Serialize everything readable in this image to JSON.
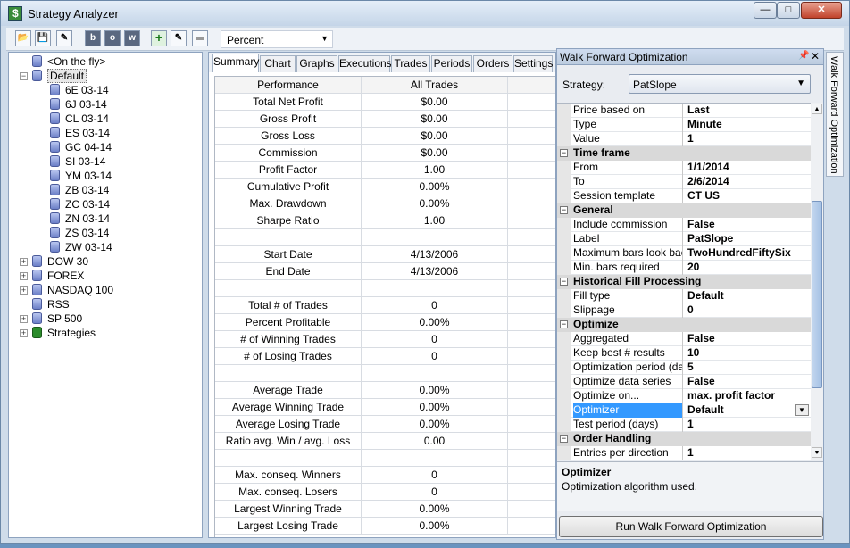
{
  "window": {
    "title": "Strategy Analyzer"
  },
  "toolbar": {
    "display_unit": "Percent",
    "btn_b": "b",
    "btn_o": "o",
    "btn_w": "w"
  },
  "tree": {
    "on_the_fly": "<On the fly>",
    "default": "Default",
    "default_children": [
      "6E 03-14",
      "6J 03-14",
      "CL 03-14",
      "ES 03-14",
      "GC 04-14",
      "SI 03-14",
      "YM 03-14",
      "ZB 03-14",
      "ZC 03-14",
      "ZN 03-14",
      "ZS 03-14",
      "ZW 03-14"
    ],
    "collapsed": [
      "DOW 30",
      "FOREX",
      "NASDAQ 100"
    ],
    "rss": "RSS",
    "sp500": "SP 500",
    "strategies": "Strategies"
  },
  "tabs": [
    "Summary",
    "Chart",
    "Graphs",
    "Executions",
    "Trades",
    "Periods",
    "Orders",
    "Settings"
  ],
  "summary": {
    "header": [
      "Performance",
      "All Trades"
    ],
    "rows": [
      [
        "Total Net Profit",
        "$0.00"
      ],
      [
        "Gross Profit",
        "$0.00"
      ],
      [
        "Gross Loss",
        "$0.00"
      ],
      [
        "Commission",
        "$0.00"
      ],
      [
        "Profit Factor",
        "1.00"
      ],
      [
        "Cumulative Profit",
        "0.00%"
      ],
      [
        "Max. Drawdown",
        "0.00%"
      ],
      [
        "Sharpe Ratio",
        "1.00"
      ],
      [
        "",
        ""
      ],
      [
        "Start Date",
        "4/13/2006"
      ],
      [
        "End Date",
        "4/13/2006"
      ],
      [
        "",
        ""
      ],
      [
        "Total # of Trades",
        "0"
      ],
      [
        "Percent Profitable",
        "0.00%"
      ],
      [
        "# of Winning Trades",
        "0"
      ],
      [
        "# of Losing Trades",
        "0"
      ],
      [
        "",
        ""
      ],
      [
        "Average Trade",
        "0.00%"
      ],
      [
        "Average Winning Trade",
        "0.00%"
      ],
      [
        "Average Losing Trade",
        "0.00%"
      ],
      [
        "Ratio avg. Win / avg. Loss",
        "0.00"
      ],
      [
        "",
        ""
      ],
      [
        "Max. conseq. Winners",
        "0"
      ],
      [
        "Max. conseq. Losers",
        "0"
      ],
      [
        "Largest Winning Trade",
        "0.00%"
      ],
      [
        "Largest Losing Trade",
        "0.00%"
      ]
    ]
  },
  "wfo": {
    "title": "Walk Forward Optimization",
    "strategy_label": "Strategy:",
    "strategy_value": "PatSlope",
    "props": [
      {
        "k": "Price based on",
        "v": "Last"
      },
      {
        "k": "Type",
        "v": "Minute"
      },
      {
        "k": "Value",
        "v": "1"
      },
      {
        "cat": "Time frame"
      },
      {
        "k": "From",
        "v": "1/1/2014"
      },
      {
        "k": "To",
        "v": "2/6/2014"
      },
      {
        "k": "Session template",
        "v": "CT US"
      },
      {
        "cat": "General"
      },
      {
        "k": "Include commission",
        "v": "False"
      },
      {
        "k": "Label",
        "v": "PatSlope"
      },
      {
        "k": "Maximum bars look back",
        "v": "TwoHundredFiftySix"
      },
      {
        "k": "Min. bars required",
        "v": "20"
      },
      {
        "cat": "Historical Fill Processing"
      },
      {
        "k": "Fill type",
        "v": "Default"
      },
      {
        "k": "Slippage",
        "v": "0"
      },
      {
        "cat": "Optimize"
      },
      {
        "k": "Aggregated",
        "v": "False"
      },
      {
        "k": "Keep best # results",
        "v": "10"
      },
      {
        "k": "Optimization period (days)",
        "v": "5"
      },
      {
        "k": "Optimize data series",
        "v": "False"
      },
      {
        "k": "Optimize on...",
        "v": "max. profit factor"
      },
      {
        "k": "Optimizer",
        "v": "Default",
        "selected": true
      },
      {
        "k": "Test period (days)",
        "v": "1"
      },
      {
        "cat": "Order Handling"
      },
      {
        "k": "Entries per direction",
        "v": "1"
      }
    ],
    "desc_title": "Optimizer",
    "desc_text": "Optimization algorithm used.",
    "run_button": "Run Walk Forward Optimization"
  },
  "side_tab": "Walk Forward Optimization"
}
